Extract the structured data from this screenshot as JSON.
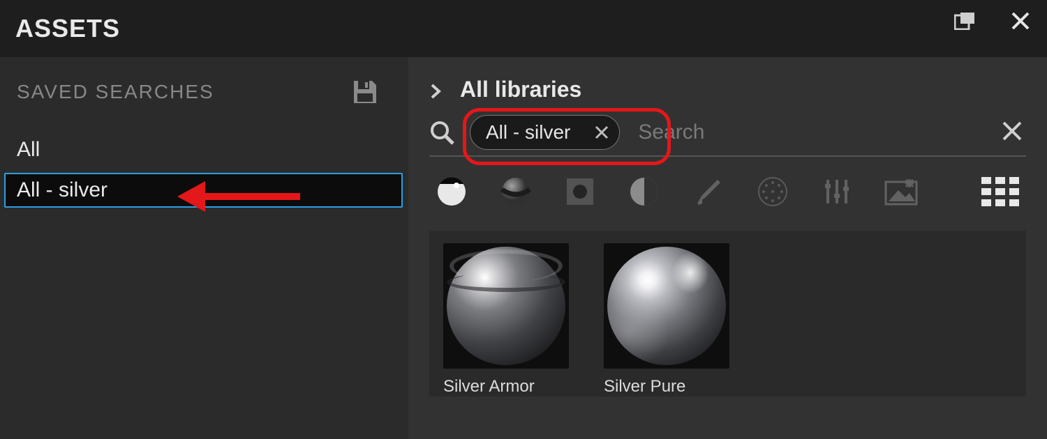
{
  "header": {
    "title": "ASSETS"
  },
  "sidebar": {
    "section_title": "SAVED SEARCHES",
    "items": [
      {
        "label": "All",
        "selected": false
      },
      {
        "label": "All - silver",
        "selected": true
      }
    ]
  },
  "main": {
    "breadcrumb": {
      "label": "All libraries"
    },
    "search": {
      "chip_label": "All - silver",
      "placeholder": "Search"
    },
    "filters": [
      {
        "name": "material-shader-icon",
        "active": true
      },
      {
        "name": "material-sphere-icon",
        "active": false
      },
      {
        "name": "texture-icon",
        "active": false
      },
      {
        "name": "bw-map-icon",
        "active": false
      },
      {
        "name": "brush-icon",
        "active": false
      },
      {
        "name": "pattern-icon",
        "active": false
      },
      {
        "name": "settings-sliders-icon",
        "active": false
      },
      {
        "name": "image-icon",
        "active": false
      }
    ],
    "results": [
      {
        "label": "Silver Armor",
        "style": "armor"
      },
      {
        "label": "Silver Pure",
        "style": "chrome"
      }
    ]
  },
  "annotations": {
    "arrow": "points to selected saved search",
    "highlight": "search chip highlighted"
  }
}
